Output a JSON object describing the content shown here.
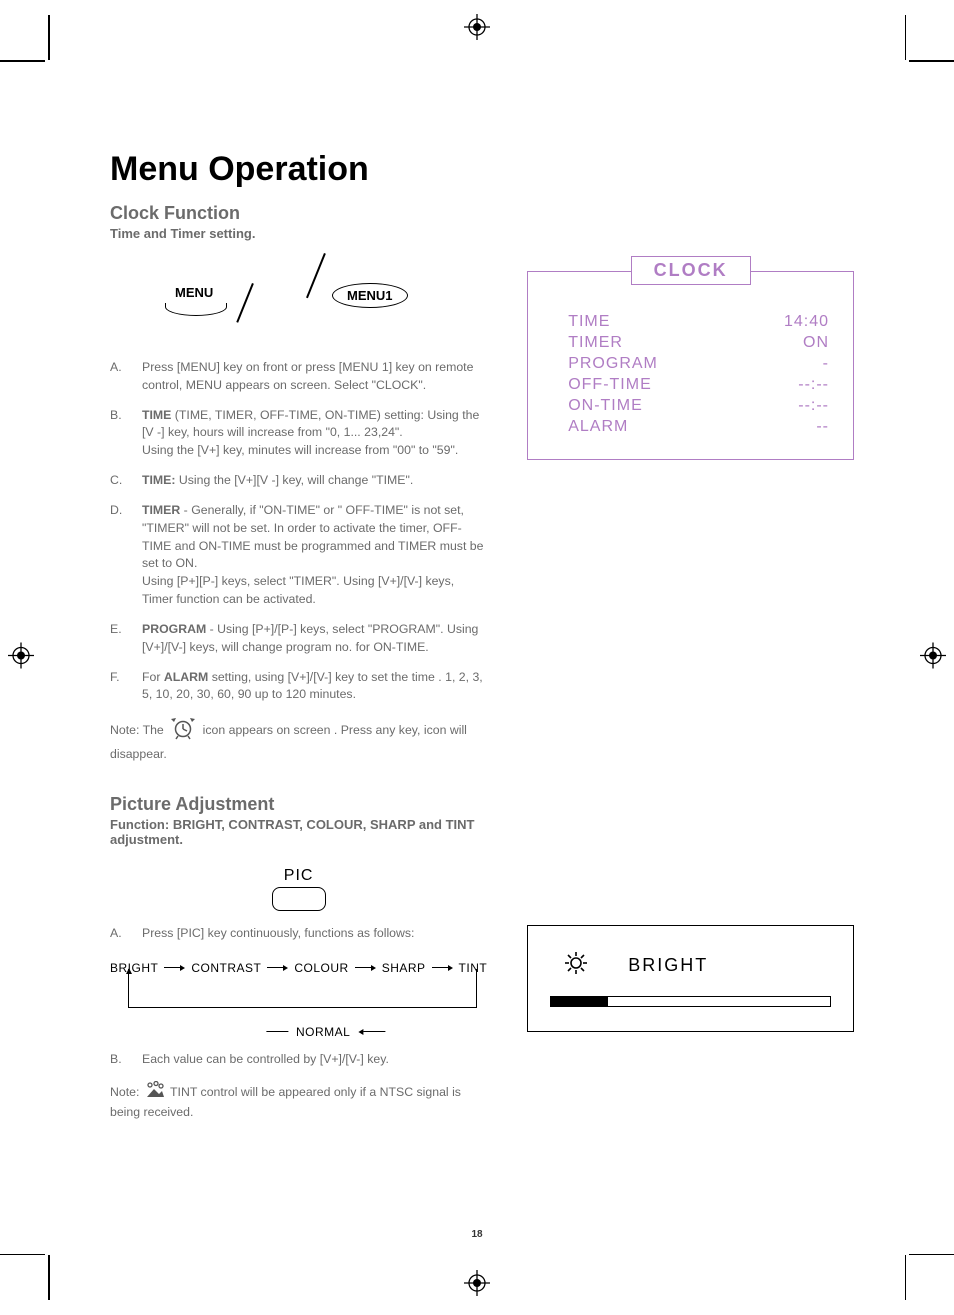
{
  "page_number": "18",
  "title": "Menu Operation",
  "section_clock": {
    "heading": "Clock Function",
    "subhead": "Time and Timer setting.",
    "menu_label": "MENU",
    "menu1_label": "MENU1",
    "steps": [
      {
        "marker": "A.",
        "html": "Press [MENU] key on front or press [MENU 1] key on remote control, MENU appears on screen. Select \"CLOCK\"."
      },
      {
        "marker": "B.",
        "html": "<b>TIME</b> (TIME, TIMER, OFF-TIME, ON-TIME) setting: Using the [V -] key, hours will increase from \"0, 1... 23,24\".<br>Using the [V+] key, minutes will increase from \"00\" to \"59\"."
      },
      {
        "marker": "C.",
        "html": "<b>TIME:</b> Using the [V+][V -] key, will change \"TIME\"."
      },
      {
        "marker": "D.",
        "html": "<b>TIMER</b> - Generally, if \"ON-TIME\" or \" OFF-TIME\" is not set, \"TIMER\" will not be set. In order to activate the timer, OFF-TIME and ON-TIME must be programmed and TIMER must be set to ON.<br>Using [P+][P-] keys, select \"TIMER\". Using [V+]/[V-] keys, Timer function can be activated."
      },
      {
        "marker": "E.",
        "html": "<b>PROGRAM</b> - Using [P+]/[P-] keys, select \"PROGRAM\". Using [V+]/[V-] keys, will change program no. for ON-TIME."
      },
      {
        "marker": "F.",
        "html": "For <b>ALARM</b> setting, using [V+]/[V-] key to set the time . 1, 2, 3, 5, 10, 20, 30, 60, 90 up to 120 minutes."
      }
    ],
    "note_prefix": "Note: The",
    "note_suffix": "icon appears on screen . Press any key, icon will disappear."
  },
  "osd_clock": {
    "title": "CLOCK",
    "rows": [
      {
        "label": "TIME",
        "value": "14:40"
      },
      {
        "label": "TIMER",
        "value": "ON"
      },
      {
        "label": "PROGRAM",
        "value": "-"
      },
      {
        "label": "OFF-TIME",
        "value": "--:--"
      },
      {
        "label": "ON-TIME",
        "value": "--:--"
      },
      {
        "label": "ALARM",
        "value": "--"
      }
    ]
  },
  "section_pic": {
    "heading": "Picture Adjustment",
    "subhead": "Function: BRIGHT, CONTRAST, COLOUR, SHARP and TINT adjustment.",
    "pic_label": "PIC",
    "step_a_marker": "A.",
    "step_a_text": "Press [PIC] key continuously, functions as follows:",
    "flow_nodes": [
      "BRIGHT",
      "CONTRAST",
      "COLOUR",
      "SHARP",
      "TINT"
    ],
    "flow_normal": "NORMAL",
    "step_b_marker": "B.",
    "step_b_text": "Each value can be controlled by [V+]/[V-] key.",
    "note_prefix": "Note:",
    "note_suffix": "TINT control will be appeared only if a NTSC signal is being received."
  },
  "osd_bright": {
    "label": "BRIGHT"
  }
}
